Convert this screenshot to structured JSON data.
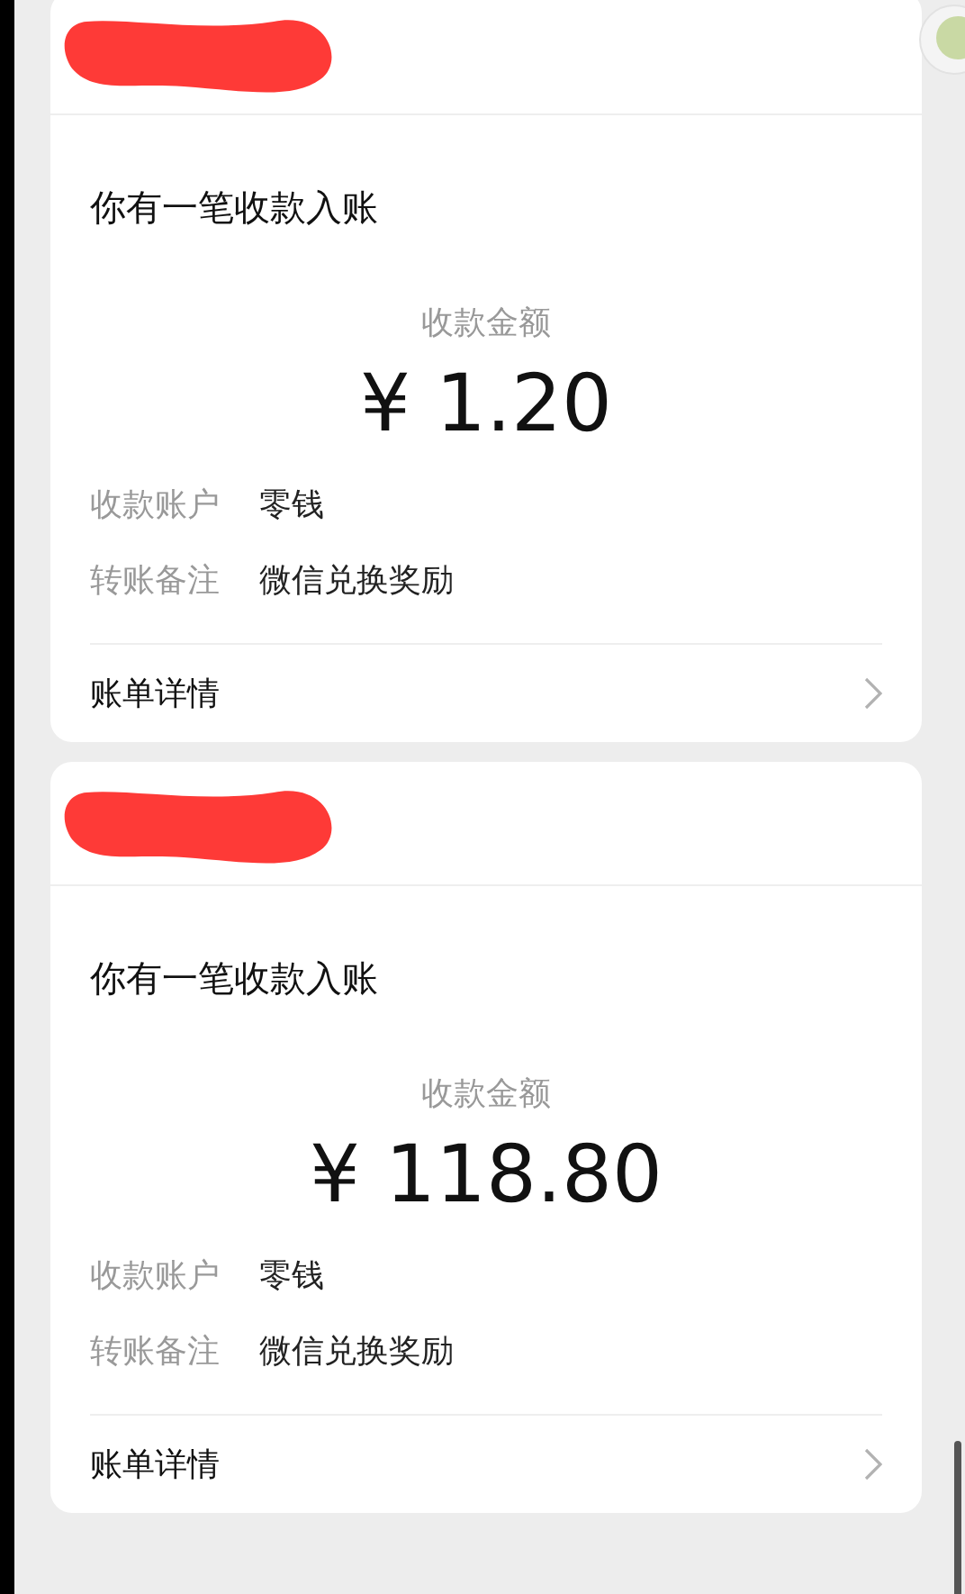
{
  "cards": [
    {
      "header_redacted": true,
      "title": "你有一笔收款入账",
      "amount_label": "收款金额",
      "amount": "¥ 1.20",
      "details": [
        {
          "label": "收款账户",
          "value": "零钱"
        },
        {
          "label": "转账备注",
          "value": "微信兑换奖励"
        }
      ],
      "link": "账单详情"
    },
    {
      "header_redacted": true,
      "title": "你有一笔收款入账",
      "amount_label": "收款金额",
      "amount": "¥ 118.80",
      "details": [
        {
          "label": "收款账户",
          "value": "零钱"
        },
        {
          "label": "转账备注",
          "value": "微信兑换奖励"
        }
      ],
      "link": "账单详情"
    }
  ]
}
